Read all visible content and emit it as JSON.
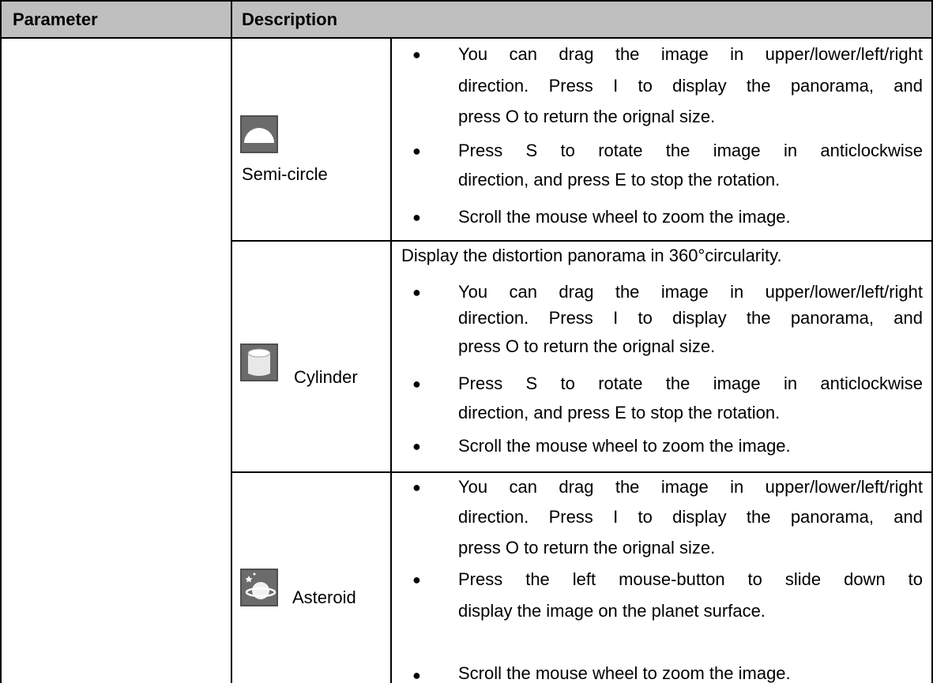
{
  "table": {
    "headers": {
      "parameter": "Parameter",
      "description": "Description"
    },
    "modes": [
      {
        "name": "Semi-circle",
        "icon": "semi-circle-icon",
        "intro": "",
        "bullets": [
          [
            "You can drag the image in upper/lower/left/right",
            "direction. Press I to display the panorama, and",
            "press O to return the orignal size."
          ],
          [
            "Press S to rotate the image in anticlockwise",
            "direction, and press E to stop the rotation."
          ],
          [
            "Scroll the mouse wheel to zoom the image."
          ]
        ]
      },
      {
        "name": "Cylinder",
        "icon": "cylinder-icon",
        "intro": "Display the distortion panorama in 360°circularity.",
        "bullets": [
          [
            "You can drag the image in upper/lower/left/right",
            "direction. Press I to display the panorama, and",
            "press O to return the orignal size."
          ],
          [
            "Press S to rotate the image in anticlockwise",
            "direction, and press E to stop the rotation."
          ],
          [
            "Scroll the mouse wheel to zoom the image."
          ]
        ]
      },
      {
        "name": "Asteroid",
        "icon": "asteroid-icon",
        "intro": "",
        "bullets": [
          [
            "You can drag the image in upper/lower/left/right",
            "direction. Press I to display the panorama, and",
            "press O to return the orignal size."
          ],
          [
            "Press the left mouse-button to slide down to",
            "display the image on the planet surface."
          ],
          [
            "Scroll the mouse wheel to zoom the image."
          ]
        ]
      }
    ]
  },
  "colors": {
    "header_bg": "#bfbfbf",
    "icon_bg": "#5a5a5a",
    "border": "#000000"
  }
}
